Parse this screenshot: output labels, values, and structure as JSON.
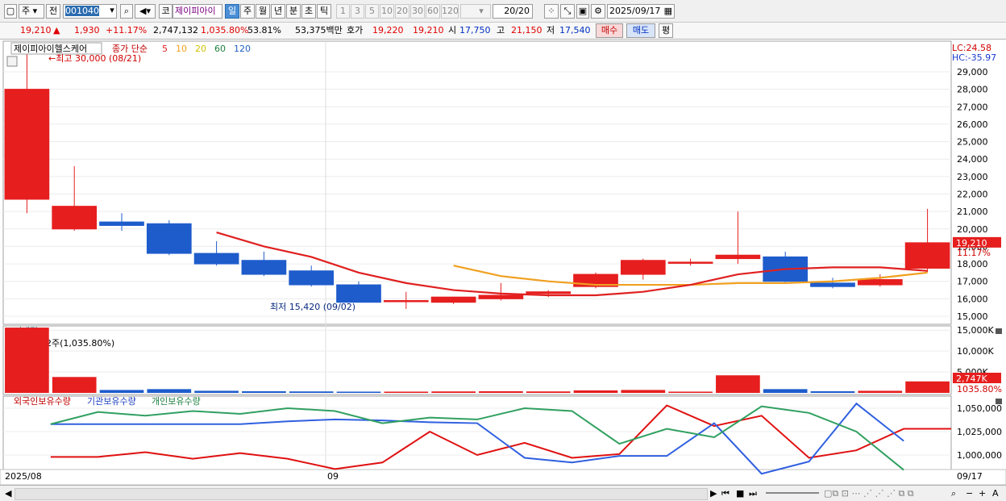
{
  "toolbar": {
    "type_label": "주",
    "jeon_label": "전",
    "code_value": "001040",
    "ko_label": "코",
    "stock_name": "제이피아이",
    "period_tabs": [
      "일",
      "주",
      "월",
      "년",
      "분",
      "초",
      "틱"
    ],
    "interval_buttons": [
      "1",
      "3",
      "5",
      "10",
      "20",
      "30",
      "60",
      "120"
    ],
    "count_display": "20/20",
    "date_value": "2025/09/17",
    "icons": [
      "window-icon",
      "dropdown-arrow-icon",
      "search-icon",
      "speaker-icon",
      "calendar-icon",
      "settings-gear-icon",
      "save-icon"
    ]
  },
  "quote": {
    "price": "19,210",
    "change": "1,930",
    "change_pct": "+11.17%",
    "volume": "2,747,132",
    "volume_ratio": "1,035.80%",
    "turnover": "53.81%",
    "amount": "53,375백만",
    "hoga_label": "호가",
    "ask": "19,220",
    "bid": "19,210",
    "open_label": "시",
    "open": "17,750",
    "high_label": "고",
    "high": "21,150",
    "low_label": "저",
    "low": "17,540",
    "buy_label": "매수",
    "sell_label": "매도",
    "eval_label": "평"
  },
  "colors": {
    "up": "#e61e1e",
    "down": "#1e5ccc",
    "ma5": "#e02020",
    "ma10": "#f0a020"
  },
  "chart_data": [
    {
      "type": "candlestick",
      "title": "제이피아이헬스케어",
      "legend": [
        "종가 단순",
        "5",
        "10",
        "20",
        "60",
        "120"
      ],
      "ylim": [
        14500,
        31500
      ],
      "yticks": [
        "29,000",
        "28,000",
        "27,000",
        "26,000",
        "25,000",
        "24,000",
        "23,000",
        "22,000",
        "21,000",
        "20,000",
        "19,000",
        "18,000",
        "17,000",
        "16,000",
        "15,000"
      ],
      "corner_labels": [
        "LC:24.58",
        "HC:-35.97"
      ],
      "last_price_label": "19,210",
      "last_pct_label": "11.17%",
      "annotations": {
        "max": "←최고 30,000 (08/21)",
        "min": "최저 15,420 (09/02)"
      },
      "x_labels": {
        "start": "2025/08",
        "mid": "09",
        "end": "09/17"
      },
      "candles": [
        {
          "o": 21700,
          "h": 30000,
          "l": 20900,
          "c": 28000
        },
        {
          "o": 20000,
          "h": 23600,
          "l": 19900,
          "c": 21300
        },
        {
          "o": 20400,
          "h": 20900,
          "l": 19900,
          "c": 20200
        },
        {
          "o": 20300,
          "h": 20500,
          "l": 18500,
          "c": 18600
        },
        {
          "o": 18600,
          "h": 19300,
          "l": 17900,
          "c": 18000
        },
        {
          "o": 18200,
          "h": 18700,
          "l": 17300,
          "c": 17400
        },
        {
          "o": 17600,
          "h": 17900,
          "l": 16700,
          "c": 16800
        },
        {
          "o": 16800,
          "h": 17000,
          "l": 15800,
          "c": 15800
        },
        {
          "o": 15900,
          "h": 16400,
          "l": 15420,
          "c": 15900
        },
        {
          "o": 15800,
          "h": 16100,
          "l": 15700,
          "c": 16100
        },
        {
          "o": 16000,
          "h": 16900,
          "l": 15900,
          "c": 16200
        },
        {
          "o": 16300,
          "h": 16500,
          "l": 16100,
          "c": 16400
        },
        {
          "o": 16700,
          "h": 17500,
          "l": 16600,
          "c": 17400
        },
        {
          "o": 17400,
          "h": 18300,
          "l": 17100,
          "c": 18200
        },
        {
          "o": 18100,
          "h": 18300,
          "l": 17900,
          "c": 18100
        },
        {
          "o": 18300,
          "h": 21000,
          "l": 18000,
          "c": 18500
        },
        {
          "o": 18400,
          "h": 18700,
          "l": 16900,
          "c": 17000
        },
        {
          "o": 16900,
          "h": 17200,
          "l": 16600,
          "c": 16700
        },
        {
          "o": 16800,
          "h": 17400,
          "l": 16700,
          "c": 17100
        },
        {
          "o": 17750,
          "h": 21150,
          "l": 17540,
          "c": 19210
        }
      ],
      "ma5": [
        null,
        null,
        null,
        null,
        19800,
        19000,
        18400,
        17500,
        16900,
        16500,
        16300,
        16200,
        16200,
        16400,
        16800,
        17400,
        17700,
        17800,
        17800,
        17600
      ],
      "ma10": [
        null,
        null,
        null,
        null,
        null,
        null,
        null,
        null,
        null,
        17900,
        17300,
        17000,
        16800,
        16800,
        16800,
        16900,
        16900,
        17000,
        17200,
        17500
      ]
    },
    {
      "type": "bar",
      "title": "거래량",
      "header_value": "2,747,132주(1,035.80%)",
      "yticks": [
        "15,000K",
        "10,000K",
        "5,000K"
      ],
      "ylim": [
        0,
        16000
      ],
      "last_label": "2,747K",
      "last_pct": "1035.80%",
      "values": [
        15600,
        3800,
        700,
        900,
        500,
        400,
        350,
        300,
        300,
        350,
        400,
        350,
        600,
        700,
        300,
        4200,
        900,
        400,
        500,
        2747
      ]
    },
    {
      "type": "line",
      "series_labels": [
        "외국인보유수량",
        "기관보유수량",
        "개인보유수량"
      ],
      "yticks": [
        "1,050,000",
        "1,025,000",
        "1,000,000"
      ],
      "series": [
        {
          "name": "외국인보유수량",
          "values": [
            null,
            998,
            998,
            1003,
            996,
            1002,
            996,
            985,
            992,
            1025,
            1000,
            1013,
            997,
            1001,
            1053,
            1031,
            1042,
            997,
            1005,
            1028,
            1028
          ]
        },
        {
          "name": "기관보유수량",
          "values": [
            null,
            1033,
            1033,
            1033,
            1033,
            1033,
            1036,
            1038,
            1037,
            1035,
            1034,
            997,
            992,
            999,
            999,
            1034,
            980,
            993,
            1055,
            1015
          ]
        },
        {
          "name": "개인보유수량",
          "values": [
            null,
            1033,
            1046,
            1042,
            1047,
            1044,
            1050,
            1047,
            1034,
            1040,
            1038,
            1050,
            1047,
            1012,
            1028,
            1019,
            1052,
            1045,
            1025,
            984
          ]
        }
      ]
    }
  ]
}
